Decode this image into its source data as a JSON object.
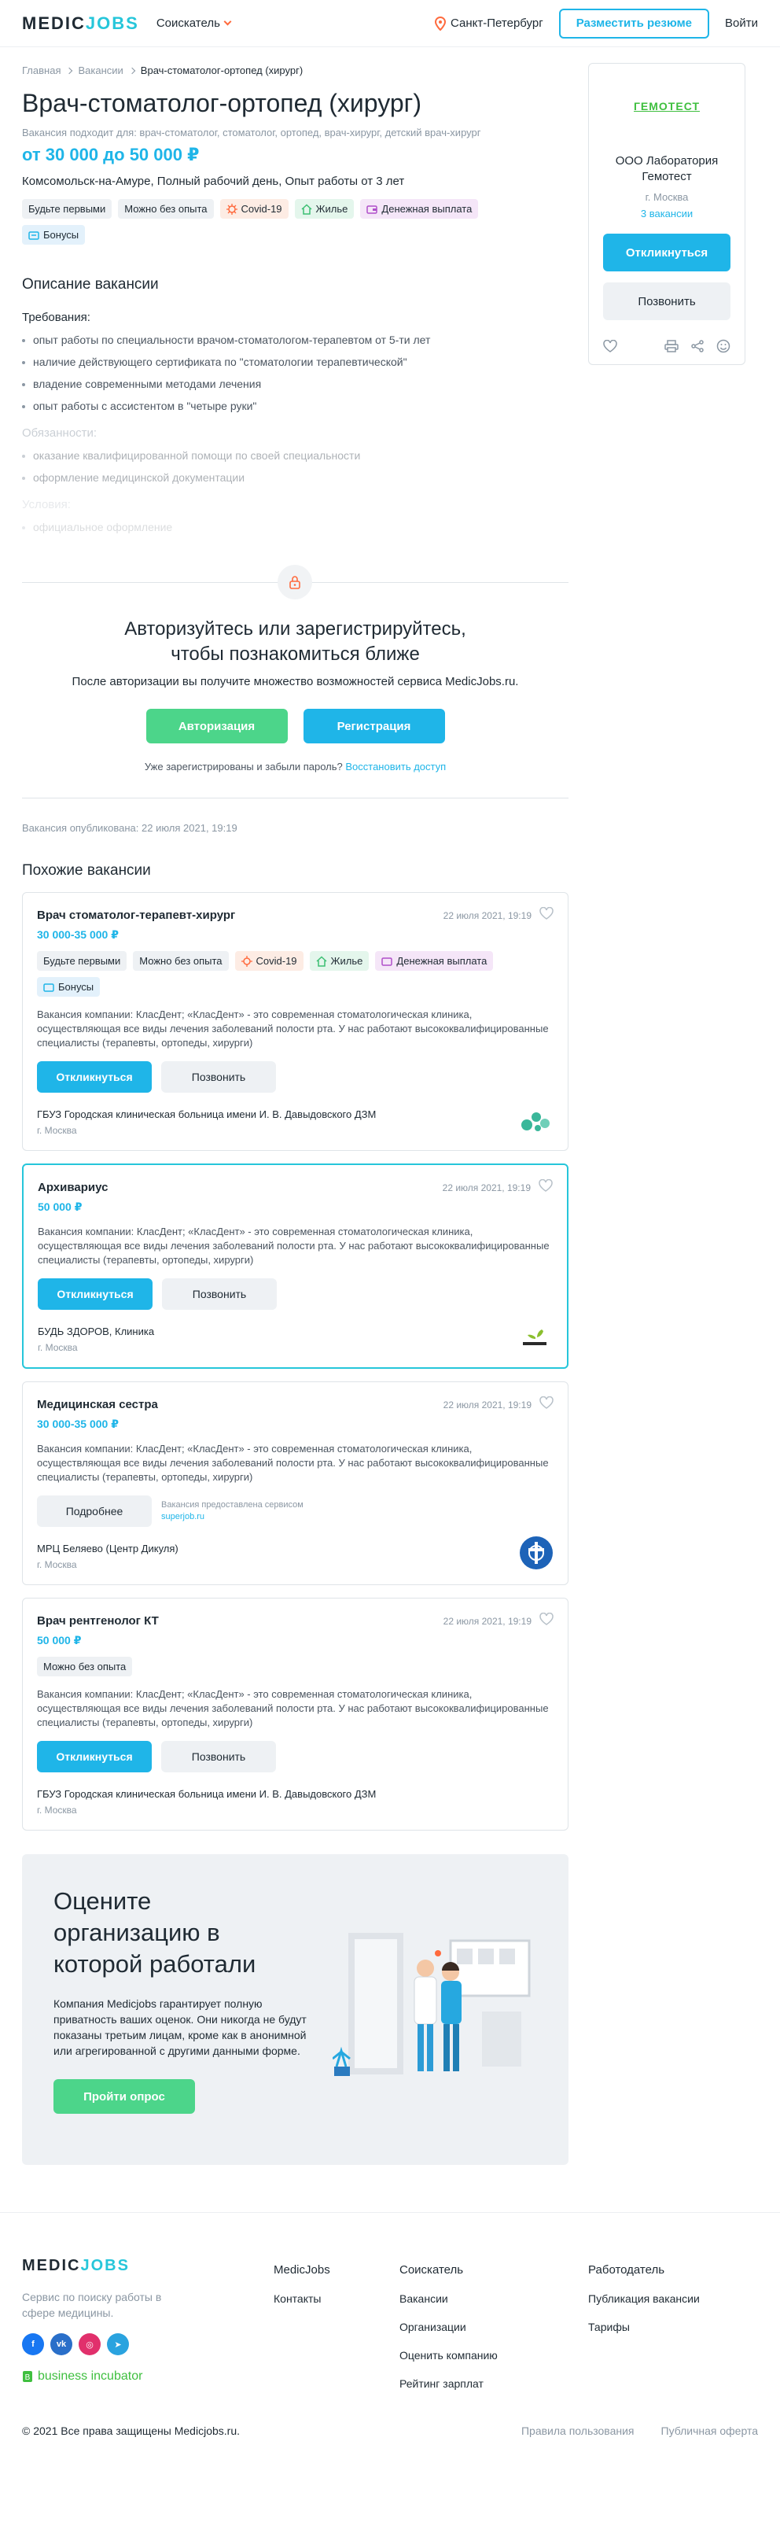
{
  "header": {
    "logo_main": "MEDIC",
    "logo_accent": "JOBS",
    "seeker_menu": "Соискатель",
    "city": "Санкт-Петербург",
    "post_resume": "Разместить резюме",
    "login": "Войти"
  },
  "breadcrumbs": [
    "Главная",
    "Вакансии",
    "Врач-стоматолог-ортопед (хирург)"
  ],
  "vacancy": {
    "title": "Врач-стоматолог-ортопед (хирург)",
    "suits": "Вакансия подходит для: врач-стоматолог, стоматолог, ортопед, врач-хирург, детский врач-хирург",
    "salary": "от 30 000 до 50 000 ₽",
    "meta": "Комсомольск-на-Амуре, Полный рабочий день, Опыт работы от 3 лет",
    "tags": [
      "Будьте первыми",
      "Можно без опыта",
      "Covid-19",
      "Жилье",
      "Денежная выплата",
      "Бонусы"
    ]
  },
  "description": {
    "heading": "Описание вакансии",
    "requirements_label": "Требования:",
    "requirements": [
      "опыт работы по специальности врачом-стоматологом-терапевтом от 5-ти лет",
      "наличие действующего сертификата по \"стоматологии терапевтической\"",
      "владение современными методами лечения",
      "опыт работы с ассистентом в \"четыре руки\""
    ],
    "duties_label": "Обязанности:",
    "duties": [
      "оказание квалифицированной помощи по своей специальности",
      "оформление медицинской документации"
    ],
    "conditions_label": "Условия:",
    "conditions": [
      "официальное оформление"
    ]
  },
  "auth": {
    "title_line1": "Авторизуйтесь или зарегистрируйтесь,",
    "title_line2": "чтобы познакомиться ближе",
    "desc": "После авторизации вы получите множество возможностей сервиса MedicJobs.ru.",
    "login_btn": "Авторизация",
    "register_btn": "Регистрация",
    "note": "Уже зарегистрированы и забыли пароль?",
    "restore": "Восстановить доступ"
  },
  "published": "Вакансия опубликована: 22 июля 2021, 19:19",
  "similar": {
    "heading": "Похожие вакансии",
    "apply_label": "Откликнуться",
    "call_label": "Позвонить",
    "more_label": "Подробнее",
    "cards": [
      {
        "title": "Врач стоматолог-терапевт-хирург",
        "date": "22 июля 2021, 19:19",
        "salary": "30 000-35 000 ₽",
        "desc": "Вакансия компании: КласДент; «КласДент» - это современная стоматологическая клиника, осуществляющая все виды лечения заболеваний полости рта. У нас работают высококвалифицированные специалисты (терапевты, ортопеды, хирурги)",
        "company": "ГБУЗ Городская клиническая больница имени И. В. Давыдовского ДЗМ",
        "city": "г. Москва"
      },
      {
        "title": "Архивариус",
        "date": "22 июля 2021, 19:19",
        "salary": "50 000 ₽",
        "desc": "Вакансия компании: КласДент; «КласДент» - это современная стоматологическая клиника, осуществляющая все виды лечения заболеваний полости рта. У нас работают высококвалифицированные специалисты (терапевты, ортопеды, хирурги)",
        "company": "БУДЬ ЗДОРОВ, Клиника",
        "city": "г. Москва"
      },
      {
        "title": "Медицинская сестра",
        "date": "22 июля 2021, 19:19",
        "salary": "30 000-35 000 ₽",
        "desc": "Вакансия компании: КласДент; «КласДент» - это современная стоматологическая клиника, осуществляющая все виды лечения заболеваний полости рта. У нас работают высококвалифицированные специалисты (терапевты, ортопеды, хирурги)",
        "provided_text": "Вакансия предоставлена сервисом",
        "provided_link": "superjob.ru",
        "company": "МРЦ Беляево (Центр Дикуля)",
        "city": "г. Москва"
      },
      {
        "title": "Врач рентгенолог КТ",
        "date": "22 июля 2021, 19:19",
        "salary": "50 000 ₽",
        "tag": "Можно без опыта",
        "desc": "Вакансия компании: КласДент; «КласДент» - это современная стоматологическая клиника, осуществляющая все виды лечения заболеваний полости рта. У нас работают высококвалифицированные специалисты (терапевты, ортопеды, хирурги)",
        "company": "ГБУЗ Городская клиническая больница имени И. В. Давыдовского ДЗМ",
        "city": "г. Москва"
      }
    ]
  },
  "survey": {
    "title": "Оцените организацию в которой работали",
    "text": "Компания Medicjobs гарантирует полную приватность ваших оценок. Они никогда не будут показаны третьим лицам, кроме как в анонимной или агрегированной с другими данными форме.",
    "button": "Пройти опрос"
  },
  "company": {
    "logo_text": "ГЕМОТЕСТ",
    "name": "ООО Лаборатория Гемотест",
    "city": "г. Москва",
    "vacancies": "3 вакансии",
    "apply": "Откликнуться",
    "call": "Позвонить"
  },
  "footer": {
    "desc": "Сервис по поиску работы в сфере медицины.",
    "biz": "business incubator",
    "col1": {
      "title": "MedicJobs",
      "links": [
        "Контакты"
      ]
    },
    "col2": {
      "title": "Соискатель",
      "links": [
        "Вакансии",
        "Организации",
        "Оценить компанию",
        "Рейтинг зарплат"
      ]
    },
    "col3": {
      "title": "Работодатель",
      "links": [
        "Публикация вакансии",
        "Тарифы"
      ]
    },
    "copyright": "© 2021 Все права защищены Medicjobs.ru.",
    "terms": "Правила пользования",
    "offer": "Публичная оферта"
  },
  "colors": {
    "accent": "#1fb5e8",
    "brand_teal": "#26c6da",
    "green": "#4cd58a",
    "orange": "#ff6a3d"
  }
}
